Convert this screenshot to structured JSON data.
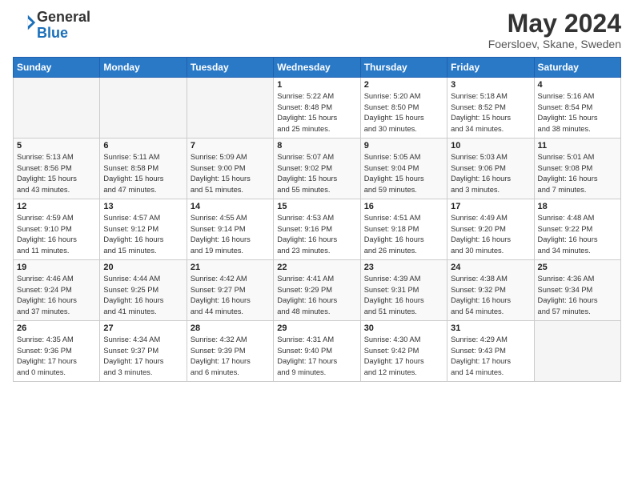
{
  "header": {
    "logo_line1": "General",
    "logo_line2": "Blue",
    "title": "May 2024",
    "subtitle": "Foersloev, Skane, Sweden"
  },
  "days_of_week": [
    "Sunday",
    "Monday",
    "Tuesday",
    "Wednesday",
    "Thursday",
    "Friday",
    "Saturday"
  ],
  "weeks": [
    [
      {
        "day": "",
        "info": ""
      },
      {
        "day": "",
        "info": ""
      },
      {
        "day": "",
        "info": ""
      },
      {
        "day": "1",
        "info": "Sunrise: 5:22 AM\nSunset: 8:48 PM\nDaylight: 15 hours\nand 25 minutes."
      },
      {
        "day": "2",
        "info": "Sunrise: 5:20 AM\nSunset: 8:50 PM\nDaylight: 15 hours\nand 30 minutes."
      },
      {
        "day": "3",
        "info": "Sunrise: 5:18 AM\nSunset: 8:52 PM\nDaylight: 15 hours\nand 34 minutes."
      },
      {
        "day": "4",
        "info": "Sunrise: 5:16 AM\nSunset: 8:54 PM\nDaylight: 15 hours\nand 38 minutes."
      }
    ],
    [
      {
        "day": "5",
        "info": "Sunrise: 5:13 AM\nSunset: 8:56 PM\nDaylight: 15 hours\nand 43 minutes."
      },
      {
        "day": "6",
        "info": "Sunrise: 5:11 AM\nSunset: 8:58 PM\nDaylight: 15 hours\nand 47 minutes."
      },
      {
        "day": "7",
        "info": "Sunrise: 5:09 AM\nSunset: 9:00 PM\nDaylight: 15 hours\nand 51 minutes."
      },
      {
        "day": "8",
        "info": "Sunrise: 5:07 AM\nSunset: 9:02 PM\nDaylight: 15 hours\nand 55 minutes."
      },
      {
        "day": "9",
        "info": "Sunrise: 5:05 AM\nSunset: 9:04 PM\nDaylight: 15 hours\nand 59 minutes."
      },
      {
        "day": "10",
        "info": "Sunrise: 5:03 AM\nSunset: 9:06 PM\nDaylight: 16 hours\nand 3 minutes."
      },
      {
        "day": "11",
        "info": "Sunrise: 5:01 AM\nSunset: 9:08 PM\nDaylight: 16 hours\nand 7 minutes."
      }
    ],
    [
      {
        "day": "12",
        "info": "Sunrise: 4:59 AM\nSunset: 9:10 PM\nDaylight: 16 hours\nand 11 minutes."
      },
      {
        "day": "13",
        "info": "Sunrise: 4:57 AM\nSunset: 9:12 PM\nDaylight: 16 hours\nand 15 minutes."
      },
      {
        "day": "14",
        "info": "Sunrise: 4:55 AM\nSunset: 9:14 PM\nDaylight: 16 hours\nand 19 minutes."
      },
      {
        "day": "15",
        "info": "Sunrise: 4:53 AM\nSunset: 9:16 PM\nDaylight: 16 hours\nand 23 minutes."
      },
      {
        "day": "16",
        "info": "Sunrise: 4:51 AM\nSunset: 9:18 PM\nDaylight: 16 hours\nand 26 minutes."
      },
      {
        "day": "17",
        "info": "Sunrise: 4:49 AM\nSunset: 9:20 PM\nDaylight: 16 hours\nand 30 minutes."
      },
      {
        "day": "18",
        "info": "Sunrise: 4:48 AM\nSunset: 9:22 PM\nDaylight: 16 hours\nand 34 minutes."
      }
    ],
    [
      {
        "day": "19",
        "info": "Sunrise: 4:46 AM\nSunset: 9:24 PM\nDaylight: 16 hours\nand 37 minutes."
      },
      {
        "day": "20",
        "info": "Sunrise: 4:44 AM\nSunset: 9:25 PM\nDaylight: 16 hours\nand 41 minutes."
      },
      {
        "day": "21",
        "info": "Sunrise: 4:42 AM\nSunset: 9:27 PM\nDaylight: 16 hours\nand 44 minutes."
      },
      {
        "day": "22",
        "info": "Sunrise: 4:41 AM\nSunset: 9:29 PM\nDaylight: 16 hours\nand 48 minutes."
      },
      {
        "day": "23",
        "info": "Sunrise: 4:39 AM\nSunset: 9:31 PM\nDaylight: 16 hours\nand 51 minutes."
      },
      {
        "day": "24",
        "info": "Sunrise: 4:38 AM\nSunset: 9:32 PM\nDaylight: 16 hours\nand 54 minutes."
      },
      {
        "day": "25",
        "info": "Sunrise: 4:36 AM\nSunset: 9:34 PM\nDaylight: 16 hours\nand 57 minutes."
      }
    ],
    [
      {
        "day": "26",
        "info": "Sunrise: 4:35 AM\nSunset: 9:36 PM\nDaylight: 17 hours\nand 0 minutes."
      },
      {
        "day": "27",
        "info": "Sunrise: 4:34 AM\nSunset: 9:37 PM\nDaylight: 17 hours\nand 3 minutes."
      },
      {
        "day": "28",
        "info": "Sunrise: 4:32 AM\nSunset: 9:39 PM\nDaylight: 17 hours\nand 6 minutes."
      },
      {
        "day": "29",
        "info": "Sunrise: 4:31 AM\nSunset: 9:40 PM\nDaylight: 17 hours\nand 9 minutes."
      },
      {
        "day": "30",
        "info": "Sunrise: 4:30 AM\nSunset: 9:42 PM\nDaylight: 17 hours\nand 12 minutes."
      },
      {
        "day": "31",
        "info": "Sunrise: 4:29 AM\nSunset: 9:43 PM\nDaylight: 17 hours\nand 14 minutes."
      },
      {
        "day": "",
        "info": ""
      }
    ]
  ]
}
